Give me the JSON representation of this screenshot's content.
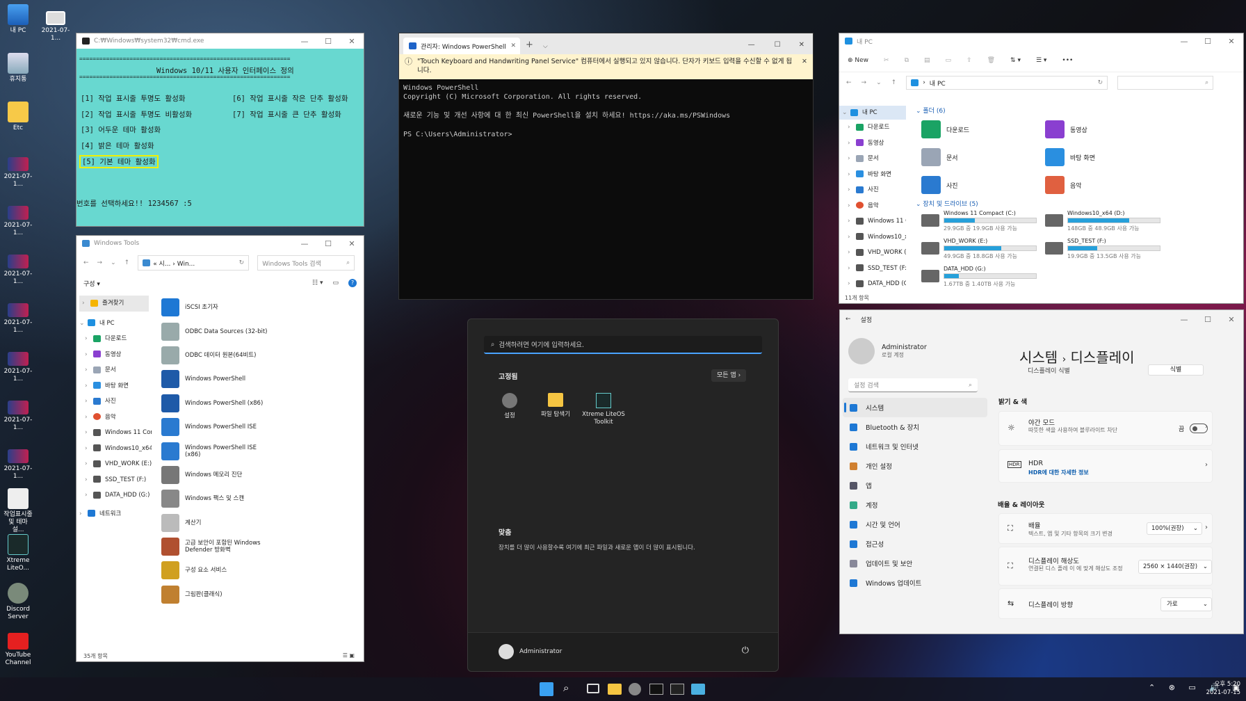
{
  "desktop": {
    "icons": [
      "내 PC",
      "2021-07-1...",
      "휴지통",
      "Etc",
      "2021-07-1...",
      "2021-07-1...",
      "2021-07-1...",
      "2021-07-1...",
      "2021-07-1...",
      "2021-07-1...",
      "2021-07-1...",
      "작업표시줄 및 테마 설...",
      "Xtreme LiteO...",
      "Discord Server",
      "YouTube Channel"
    ]
  },
  "cmd": {
    "title": "C:₩Windows₩system32₩cmd.exe",
    "sep": "===============================================================",
    "heading": "Windows 10/11 사용자 인터페이스 정의",
    "opt1": "[1] 작업 표시줄 투명도 활성화",
    "opt2": "[2] 작업 표시줄 투명도 비활성화",
    "opt3": "[3] 어두운 테마 활성화",
    "opt4": "[4] 밝은 테마 활성화",
    "opt5": "[5] 기본 테마 활성화",
    "opt6": "[6] 작업 표시줄 작은 단추 활성화",
    "opt7": "[7] 작업 표시줄 큰 단추 활성화",
    "prompt": "번호를 선택하세요!! 1234567 :5"
  },
  "ps": {
    "tab": "관리자: Windows PowerShell",
    "warning": "\"Touch Keyboard and Handwriting Panel Service\" 컴퓨터에서 실행되고 있지 않습니다. 단자가 키보드 입력을 수신할 수 없게 됩니다.",
    "l1": "Windows PowerShell",
    "l2": "Copyright (C) Microsoft Corporation. All rights reserved.",
    "l3": "새로운 기능 및 개선 사항에 대 한 최신 PowerShell을 설치 하세요! https://aka.ms/PSWindows",
    "l4": "PS C:\\Users\\Administrator>"
  },
  "explorer": {
    "title": "내 PC",
    "new": "New",
    "address": "내 PC",
    "nav": [
      "내 PC",
      "다운로드",
      "동영상",
      "문서",
      "바탕 화면",
      "사진",
      "음악",
      "Windows 11 C",
      "Windows10_x6",
      "VHD_WORK (E",
      "SSD_TEST (F:)",
      "DATA_HDD (G"
    ],
    "folders_header": "폴더 (6)",
    "folders": [
      "다운로드",
      "동영상",
      "문서",
      "바탕 화면",
      "사진",
      "음악"
    ],
    "drives_header": "장치 및 드라이브 (5)",
    "drives": [
      {
        "name": "Windows 11 Compact (C:)",
        "info": "29.9GB 중 19.9GB 사용 가능",
        "fill": 0.33
      },
      {
        "name": "Windows10_x64 (D:)",
        "info": "148GB 중 48.9GB 사용 가능",
        "fill": 0.67
      },
      {
        "name": "VHD_WORK (E:)",
        "info": "49.9GB 중 18.8GB 사용 가능",
        "fill": 0.62
      },
      {
        "name": "SSD_TEST (F:)",
        "info": "19.9GB 중 13.5GB 사용 가능",
        "fill": 0.32
      },
      {
        "name": "DATA_HDD (G:)",
        "info": "1.67TB 중 1.40TB 사용 가능",
        "fill": 0.16
      }
    ],
    "status": "11개 항목"
  },
  "tools": {
    "title": "Windows Tools",
    "address": "« 시... › Win...",
    "search": "Windows Tools 검색",
    "organize": "구성 ▾",
    "nav": [
      "즐겨찾기",
      "내 PC",
      "다운로드",
      "동영상",
      "문서",
      "바탕 화면",
      "사진",
      "음악",
      "Windows 11 Com",
      "Windows10_x64 (",
      "VHD_WORK (E:)",
      "SSD_TEST (F:)",
      "DATA_HDD (G:)",
      "네트워크"
    ],
    "items": [
      "iSCSI 초기자",
      "ODBC Data Sources (32-bit)",
      "ODBC 데이터 원본(64비트)",
      "Windows PowerShell",
      "Windows PowerShell (x86)",
      "Windows PowerShell ISE",
      "Windows PowerShell ISE (x86)",
      "Windows 메모리 진단",
      "Windows 팩스 및 스캔",
      "계산기",
      "고급 보안이 포함된 Windows Defender 방화벽",
      "구성 요소 서비스",
      "그림판(클래식)"
    ],
    "status": "35개 항목"
  },
  "start": {
    "search": "검색하려면 여기에 입력하세요.",
    "pinned": "고정됨",
    "all": "모든 앱",
    "apps": [
      "설정",
      "파일 탐색기",
      "Xtreme LiteOS Toolkit"
    ],
    "rec": "맞춤",
    "rec_text": "장치를 더 많이 사용할수록 여기에 최근 파일과 새로운 앱이 더 많이 표시됩니다.",
    "user": "Administrator"
  },
  "settings": {
    "title": "설정",
    "user": "Administrator",
    "account": "로컬 계정",
    "search": "설정 검색",
    "crumb1": "시스템",
    "crumb2": "디스플레이",
    "top_cut": "디스플레이 식별",
    "top_btn": "식별",
    "menu": [
      "시스템",
      "Bluetooth & 장치",
      "네트워크 및 인터넷",
      "개인 설정",
      "앱",
      "계정",
      "시간 및 언어",
      "접근성",
      "업데이트 및 보안",
      "Windows 업데이트"
    ],
    "sec1": "밝기 & 색",
    "night": "야간 모드",
    "night_sub": "따뜻한 색을 사용하여 블루라이트 차단",
    "night_state": "끔",
    "hdr": "HDR",
    "hdr_link": "HDR에 대한 자세한 정보",
    "sec2": "배율 & 레이아웃",
    "scale": "배율",
    "scale_sub": "텍스트, 앱 및 기타 항목의 크기 변경",
    "scale_val": "100%(권장)",
    "res": "디스플레이 해상도",
    "res_sub": "연결된 디스 플레 이 에 맞게 해상도 조정",
    "res_val": "2560 × 1440(권장)",
    "orient": "디스플레이 방향",
    "orient_val": "가로"
  },
  "taskbar": {
    "time": "오후 5:20",
    "date": "2021-07-15"
  }
}
